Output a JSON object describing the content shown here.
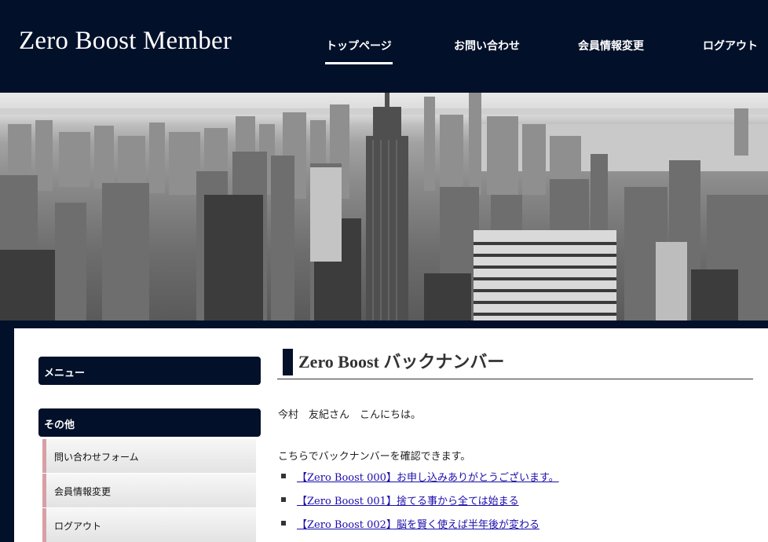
{
  "header": {
    "site_title": "Zero Boost Member",
    "nav": [
      {
        "label": "トップページ",
        "active": true
      },
      {
        "label": "お問い合わせ",
        "active": false
      },
      {
        "label": "会員情報変更",
        "active": false
      },
      {
        "label": "ログアウト",
        "active": false
      }
    ]
  },
  "hero": {
    "image": "black-and-white city skyline photo"
  },
  "sidebar": {
    "menu_heading": "メニュー",
    "other_heading": "その他",
    "links": [
      "問い合わせフォーム",
      "会員情報変更",
      "ログアウト"
    ]
  },
  "main": {
    "title": "Zero Boost バックナンバー",
    "greeting": "今村　友紀さん　こんにちは。",
    "intro": "こちらでバックナンバーを確認できます。",
    "issues": [
      "【Zero Boost 000】お申し込みありがとうございます。",
      "【Zero Boost 001】捨てる事から全ては始まる",
      "【Zero Boost 002】脳を賢く使えば半年後が変わる"
    ]
  },
  "colors": {
    "navy": "#03102a",
    "link": "#1a0dab",
    "sidebar_accent": "#d8a0a6"
  }
}
